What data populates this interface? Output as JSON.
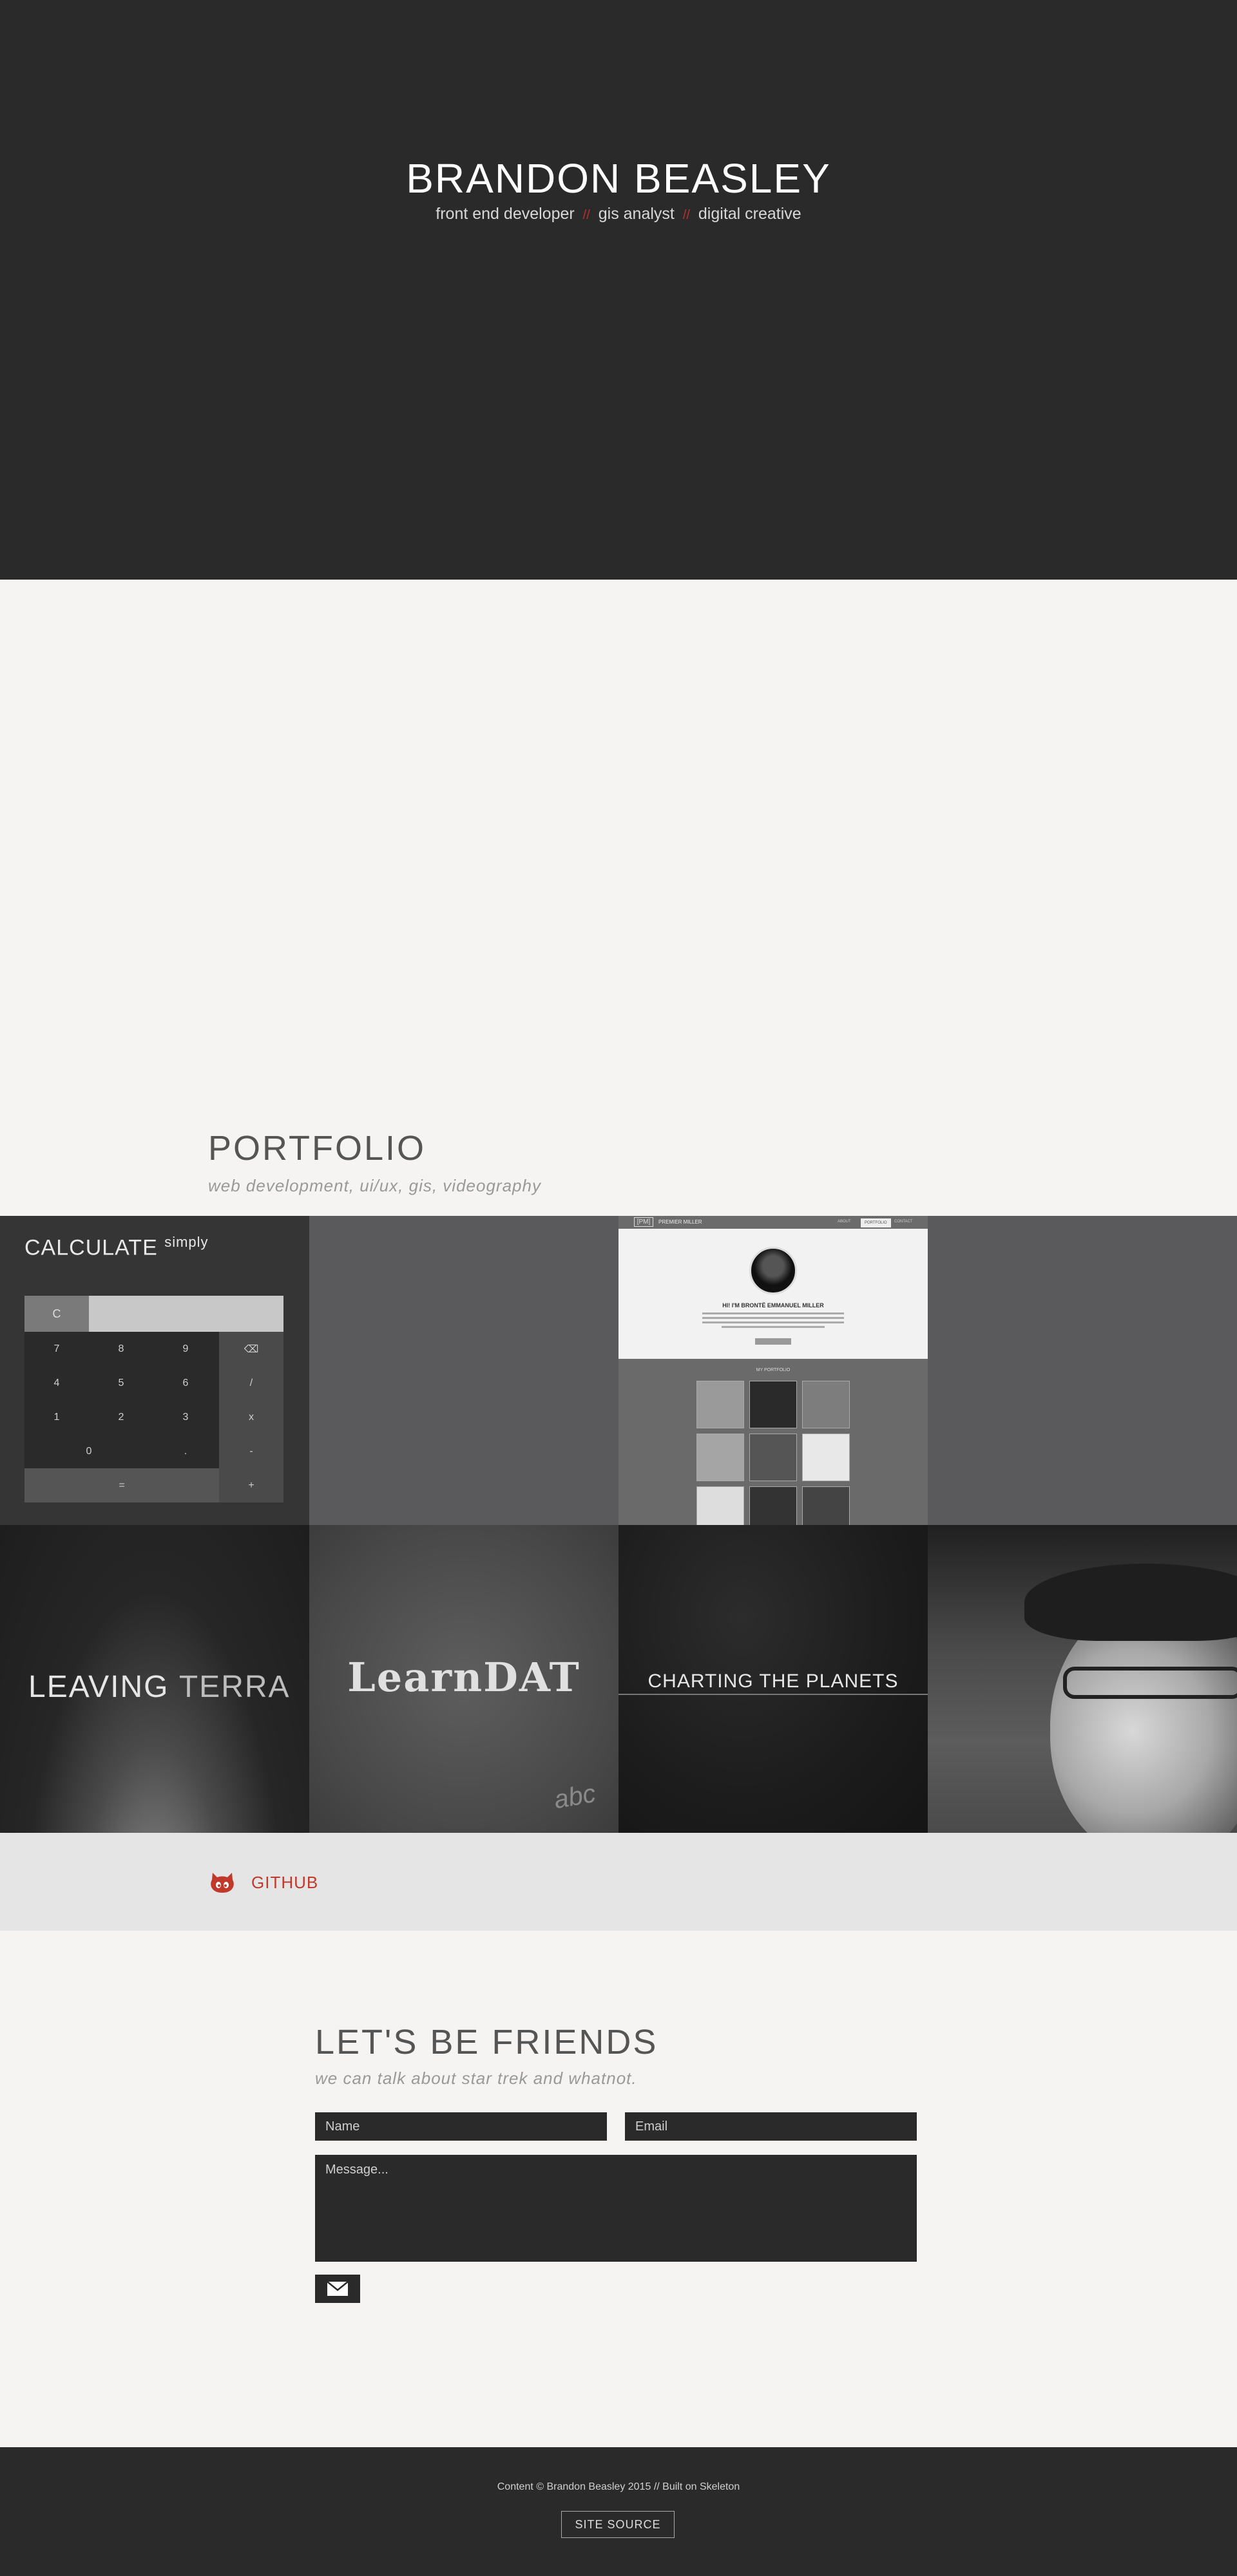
{
  "hero": {
    "name": "BRANDON BEASLEY",
    "roles": [
      "front end developer",
      "gis analyst",
      "digital creative"
    ],
    "separator": "//"
  },
  "portfolio": {
    "title": "PORTFOLIO",
    "subtitle": "web development, ui/ux, gis, videography",
    "calculator": {
      "title": "CALCULATE",
      "title_sup": "simply",
      "clear": "C",
      "keys": [
        "7",
        "8",
        "9",
        "4",
        "5",
        "6",
        "1",
        "2",
        "3",
        "0",
        "."
      ],
      "ops": [
        "⌫",
        "/",
        "x",
        "-",
        "+"
      ],
      "equals": "="
    },
    "site_preview": {
      "logo": "[PM]",
      "brand": "PREMIER MILLER",
      "nav": [
        "ABOUT",
        "PORTFOLIO",
        "CONTACT"
      ],
      "hello": "HI! I'M BRONTË EMMANUEL MILLER",
      "portfolio_label": "MY PORTFOLIO"
    },
    "tiles": {
      "terra_a": "LEAVING",
      "terra_b": "TERRA",
      "learn": "LearnDAT",
      "learn_chalk": "abc",
      "planets": "CHARTING THE PLANETS"
    }
  },
  "github": {
    "label": "GITHUB",
    "icon": "github-icon",
    "accent": "#c0392b"
  },
  "contact": {
    "title": "LET'S BE FRIENDS",
    "subtitle": "we can talk about star trek and whatnot.",
    "name_placeholder": "Name",
    "email_placeholder": "Email",
    "message_placeholder": "Message...",
    "send_icon": "envelope-icon"
  },
  "footer": {
    "text": "Content © Brandon Beasley 2015 // Built on Skeleton",
    "button": "SITE SOURCE"
  }
}
